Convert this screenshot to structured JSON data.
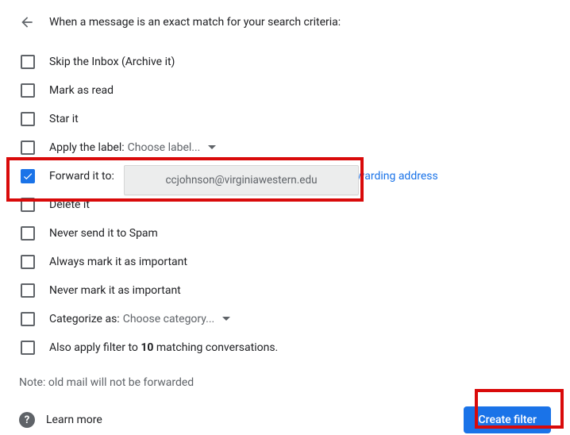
{
  "header": {
    "text": "When a message is an exact match for your search criteria:"
  },
  "options": {
    "skip_inbox": "Skip the Inbox (Archive it)",
    "mark_read": "Mark as read",
    "star_it": "Star it",
    "apply_label_prefix": "Apply the label:",
    "apply_label_select": "Choose label...",
    "forward_prefix": "Forward it to:",
    "forward_link_suffix": "rwarding address",
    "forward_email": "ccjohnson@virginiawestern.edu",
    "delete_it": "Delete it",
    "never_spam": "Never send it to Spam",
    "always_important": "Always mark it as important",
    "never_important": "Never mark it as important",
    "categorize_prefix": "Categorize as:",
    "categorize_select": "Choose category...",
    "also_apply_prefix": "Also apply filter to ",
    "also_apply_count": "10",
    "also_apply_suffix": " matching conversations."
  },
  "note": "Note: old mail will not be forwarded",
  "footer": {
    "learn_more": "Learn more",
    "create_filter": "Create filter"
  }
}
